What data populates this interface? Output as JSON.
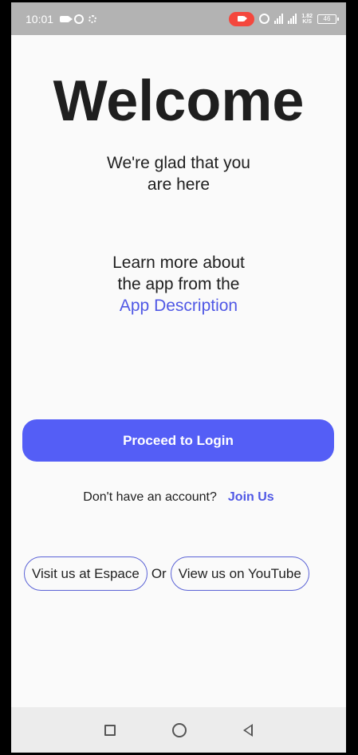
{
  "status_bar": {
    "time": "10:01",
    "network_label": "1.82",
    "network_sub": "K/S",
    "battery": "46"
  },
  "welcome": {
    "title": "Welcome",
    "subtitle_line1": "We're glad that you",
    "subtitle_line2": "are here"
  },
  "learn_more": {
    "line1": "Learn more about",
    "line2": "the app from the",
    "link": "App Description"
  },
  "actions": {
    "proceed_label": "Proceed to Login",
    "signup_prompt": "Don't have an account?",
    "join_label": "Join Us"
  },
  "external_links": {
    "espace_label": "Visit us at Espace",
    "or_text": "Or",
    "youtube_label": "View us on YouTube"
  },
  "colors": {
    "primary": "#545ef6",
    "link": "#5058e5",
    "background": "#fafafa",
    "status_bar": "#b3b3b3",
    "record_badge": "#f4473d"
  }
}
